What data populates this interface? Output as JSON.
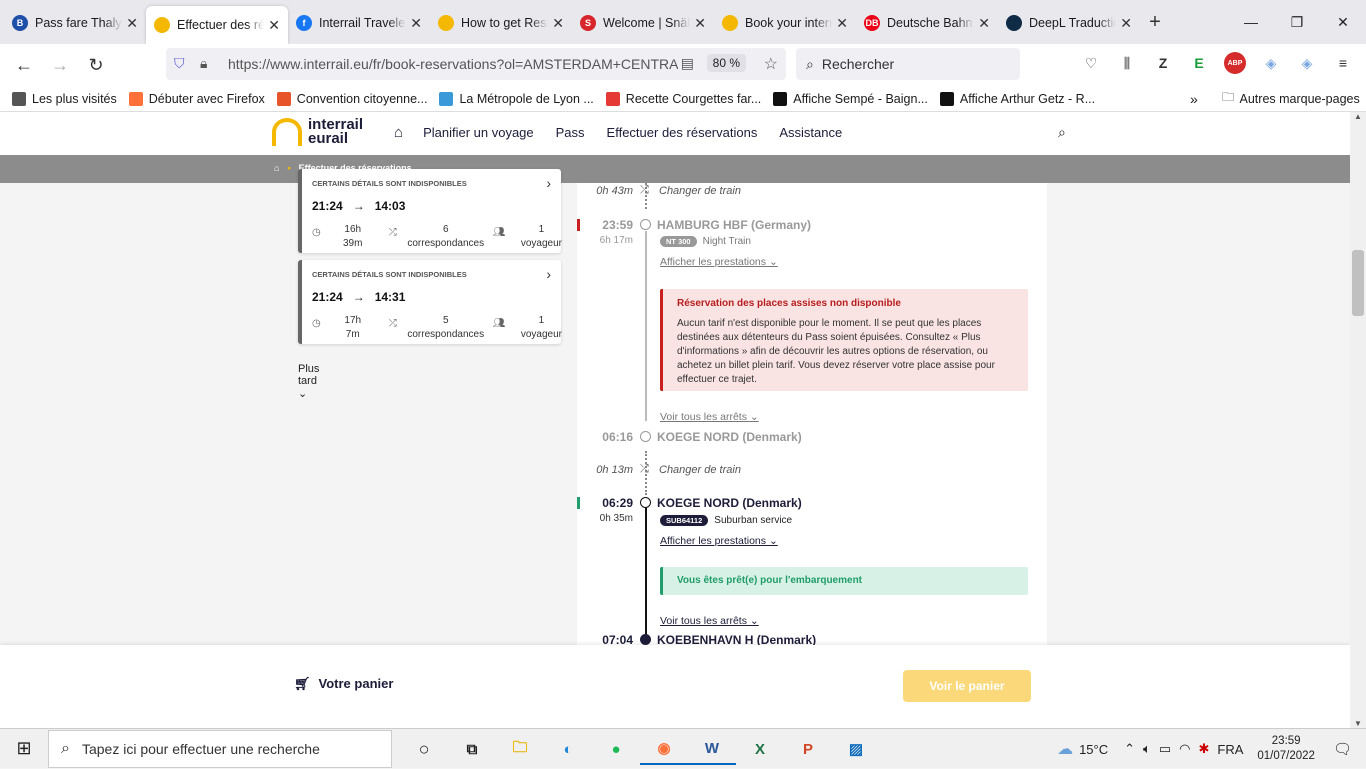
{
  "browser": {
    "tabs": [
      {
        "label": "Pass fare Thalys",
        "icon": "B",
        "color": "#1f4fa8",
        "active": false
      },
      {
        "label": "Effectuer des rés",
        "icon": "",
        "color": "#f5b800",
        "active": true
      },
      {
        "label": "Interrail Travelers",
        "icon": "f",
        "color": "#1877f2",
        "active": false
      },
      {
        "label": "How to get Rese",
        "icon": "",
        "color": "#f5b800",
        "active": false
      },
      {
        "label": "Welcome | Snälltå",
        "icon": "S",
        "color": "#d6262b",
        "active": false
      },
      {
        "label": "Book your intern",
        "icon": "",
        "color": "#f5b800",
        "active": false
      },
      {
        "label": "Deutsche Bahn: I",
        "icon": "DB",
        "color": "#ec0016",
        "active": false
      },
      {
        "label": "DeepL Traduction",
        "icon": "",
        "color": "#0f2b46",
        "active": false
      }
    ],
    "url": "https://www.interrail.eu/fr/book-reservations?ol=AMSTERDAM+CENTRAAL",
    "zoom": "80 %",
    "search_placeholder": "Rechercher",
    "bookmarks": [
      "Les plus visités",
      "Débuter avec Firefox",
      "Convention citoyenne...",
      "La Métropole de Lyon ...",
      "Recette Courgettes far...",
      "Affiche Sempé - Baign...",
      "Affiche Arthur Getz - R..."
    ],
    "other_bookmarks": "Autres marque-pages"
  },
  "site": {
    "logo_line1": "interrail",
    "logo_line2": "eurail",
    "menu": [
      "Planifier un voyage",
      "Pass",
      "Effectuer des réservations",
      "Assistance"
    ],
    "breadcrumb": "Effectuer des réservations"
  },
  "cards": [
    {
      "label": "CERTAINS DÉTAILS SONT INDISPONIBLES",
      "dep": "21:24",
      "arr": "14:03",
      "dur1": "16h",
      "dur2": "39m",
      "conn1": "6",
      "conn2": "correspondances",
      "pax1": "1",
      "pax2": "voyageur"
    },
    {
      "label": "CERTAINS DÉTAILS SONT INDISPONIBLES",
      "dep": "21:24",
      "arr": "14:31",
      "dur1": "17h",
      "dur2": "7m",
      "conn1": "5",
      "conn2": "correspondances",
      "pax1": "1",
      "pax2": "voyageur"
    }
  ],
  "plus_tard": "Plus tard",
  "journey": {
    "change1_dur": "0h 43m",
    "change1_label": "Changer de train",
    "stop1_time": "23:59",
    "stop1_name": "HAMBURG HBF (Germany)",
    "stop1_dur": "6h 17m",
    "stop1_badge": "NT 300",
    "stop1_type": "Night Train",
    "stop1_link": "Afficher les prestations",
    "alert_title": "Réservation des places assises non disponible",
    "alert_text": "Aucun tarif n'est disponible pour le moment. Il se peut que les places destinées aux détenteurs du Pass soient épuisées. Consultez « Plus d'informations » afin de découvrir les autres options de réservation, ou achetez un billet plein tarif. Vous devez réserver votre place assise pour effectuer ce trajet.",
    "all_stops1": "Voir tous les arrêts",
    "stop2_time": "06:16",
    "stop2_name": "KOEGE NORD (Denmark)",
    "change2_dur": "0h 13m",
    "change2_label": "Changer de train",
    "stop3_time": "06:29",
    "stop3_name": "KOEGE NORD (Denmark)",
    "stop3_dur": "0h 35m",
    "stop3_badge": "SUB64112",
    "stop3_type": "Suburban service",
    "stop3_link": "Afficher les prestations",
    "ok_text": "Vous êtes prêt(e) pour l'embarquement",
    "all_stops2": "Voir tous les arrêts",
    "stop4_time": "07:04",
    "stop4_name": "KOEBENHAVN H (Denmark)"
  },
  "footer": {
    "cart": "Votre panier",
    "button": "Voir le panier"
  },
  "taskbar": {
    "search": "Tapez ici pour effectuer une recherche",
    "temp": "15°C",
    "lang": "FRA",
    "time": "23:59",
    "date": "01/07/2022"
  }
}
